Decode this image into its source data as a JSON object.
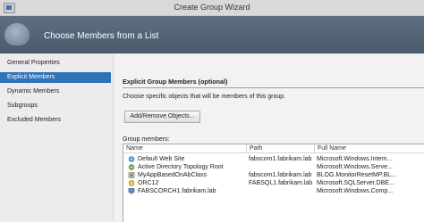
{
  "window": {
    "title": "Create Group Wizard"
  },
  "banner": {
    "heading": "Choose Members from a List"
  },
  "sidebar": {
    "items": [
      {
        "label": "General Properties",
        "selected": false
      },
      {
        "label": "Explicit Members",
        "selected": true
      },
      {
        "label": "Dynamic Members",
        "selected": false
      },
      {
        "label": "Subgroups",
        "selected": false
      },
      {
        "label": "Excluded Members",
        "selected": false
      }
    ]
  },
  "main": {
    "section_title": "Explicit Group Members (optional)",
    "description": "Choose specific objects that will be members of this group.",
    "add_remove_label": "Add/Remove Objects...",
    "members_label": "Group members:",
    "columns": [
      "Name",
      "Path",
      "Full Name"
    ],
    "rows": [
      {
        "icon": "globe-icon",
        "name": "Default Web Site",
        "path": "fabscom1.fabrikam.lab",
        "full_name": "Microsoft.Windows.Intern..."
      },
      {
        "icon": "topology-icon",
        "name": "Active Directory Topology Root",
        "path": "",
        "full_name": "Microsoft.Windows.Serve..."
      },
      {
        "icon": "class-icon",
        "name": "MyAppBasedOnAbClass",
        "path": "fabscom1.fabrikam.lab",
        "full_name": "BLOG.MonitorResetMP.BL..."
      },
      {
        "icon": "database-icon",
        "name": "ORC12",
        "path": "FABSQL1.fabrikam.lab",
        "full_name": "Microsoft.SQLServer.DBE..."
      },
      {
        "icon": "computer-icon",
        "name": "FABSCORCH1.fabrikam.lab",
        "path": "",
        "full_name": "Microsoft.Windows.Comp..."
      }
    ]
  },
  "colors": {
    "accent": "#2f72b8",
    "banner": "#556677"
  }
}
